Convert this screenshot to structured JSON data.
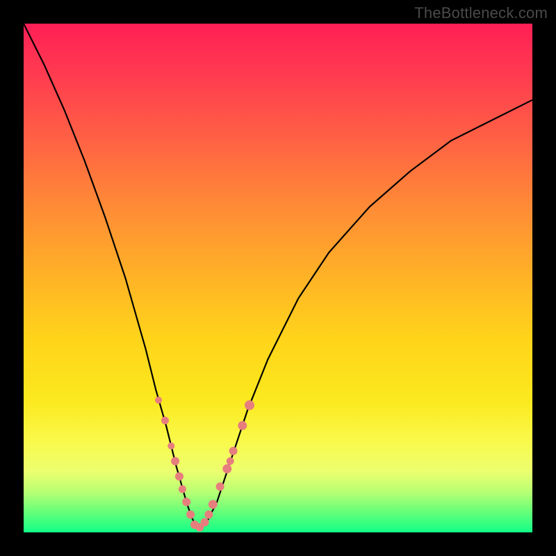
{
  "watermark": "TheBottleneck.com",
  "chart_data": {
    "type": "line",
    "title": "",
    "xlabel": "",
    "ylabel": "",
    "xlim": [
      0,
      100
    ],
    "ylim": [
      0,
      100
    ],
    "grid": false,
    "series": [
      {
        "name": "bottleneck-curve",
        "x": [
          0,
          4,
          8,
          12,
          16,
          20,
          24,
          26,
          28,
          30,
          32,
          33,
          34,
          35,
          36,
          38,
          40,
          44,
          48,
          54,
          60,
          68,
          76,
          84,
          92,
          100
        ],
        "y": [
          100,
          92,
          83,
          73,
          62,
          50,
          36,
          28,
          21,
          13,
          6,
          3,
          1,
          1,
          2,
          6,
          12,
          24,
          34,
          46,
          55,
          64,
          71,
          77,
          81,
          85
        ]
      }
    ],
    "markers": {
      "name": "highlighted-points",
      "x": [
        26.5,
        27.8,
        29.0,
        29.8,
        30.6,
        31.2,
        32.0,
        32.8,
        33.6,
        34.6,
        35.6,
        36.4,
        37.2,
        38.6,
        40.0,
        40.6,
        41.2,
        43.0,
        44.4
      ],
      "y": [
        26.0,
        22.0,
        17.0,
        14.0,
        11.0,
        8.5,
        6.0,
        3.5,
        1.5,
        1.0,
        2.0,
        3.5,
        5.5,
        9.0,
        12.5,
        14.0,
        16.0,
        21.0,
        25.0
      ],
      "radius": [
        5.0,
        5.5,
        5.0,
        6.0,
        6.0,
        5.5,
        6.0,
        6.0,
        6.0,
        6.0,
        6.0,
        6.0,
        6.5,
        6.0,
        6.5,
        5.5,
        6.0,
        6.5,
        7.0
      ]
    },
    "colors": {
      "curve": "#000000",
      "marker_fill": "#e77e7e",
      "marker_stroke": "#9d4040"
    }
  }
}
